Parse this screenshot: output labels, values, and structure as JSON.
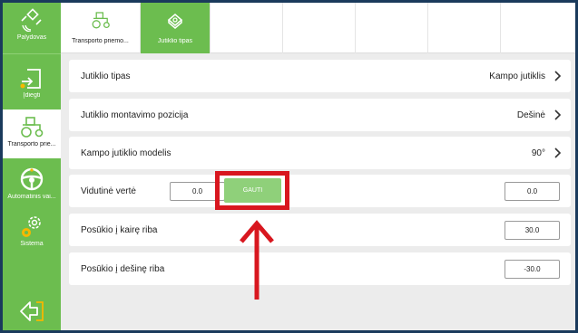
{
  "sidebar": {
    "items": [
      {
        "label": "Palydovas",
        "icon": "satellite-icon"
      },
      {
        "label": "Įdiegti",
        "icon": "install-icon"
      },
      {
        "label": "Transporto prie...",
        "icon": "tractor-icon",
        "active": true
      },
      {
        "label": "Automatinis vai...",
        "icon": "steering-wheel-icon"
      },
      {
        "label": "Sistema",
        "icon": "gears-icon"
      }
    ],
    "back_icon": "back-arrow-icon"
  },
  "tabs": [
    {
      "label": "Transporto priemo...",
      "icon": "tractor-icon"
    },
    {
      "label": "Jutiklio tipas",
      "icon": "sensor-icon",
      "active": true
    }
  ],
  "rows": {
    "sensor_type": {
      "label": "Jutiklio tipas",
      "value": "Kampo jutiklis"
    },
    "mount_position": {
      "label": "Jutiklio montavimo pozicija",
      "value": "Dešinė"
    },
    "sensor_model": {
      "label": "Kampo jutiklio modelis",
      "value": "90°"
    },
    "average": {
      "label": "Vidutinė vertė",
      "value_left": "0.0",
      "button": "GAUTI",
      "value_right": "0.0"
    },
    "left_limit": {
      "label": "Posūkio į kairę riba",
      "value": "30.0"
    },
    "right_limit": {
      "label": "Posūkio į dešinę riba",
      "value": "-30.0"
    }
  },
  "colors": {
    "accent": "#6cbd4f",
    "highlight": "#d8171f",
    "button": "#8fd07a"
  }
}
